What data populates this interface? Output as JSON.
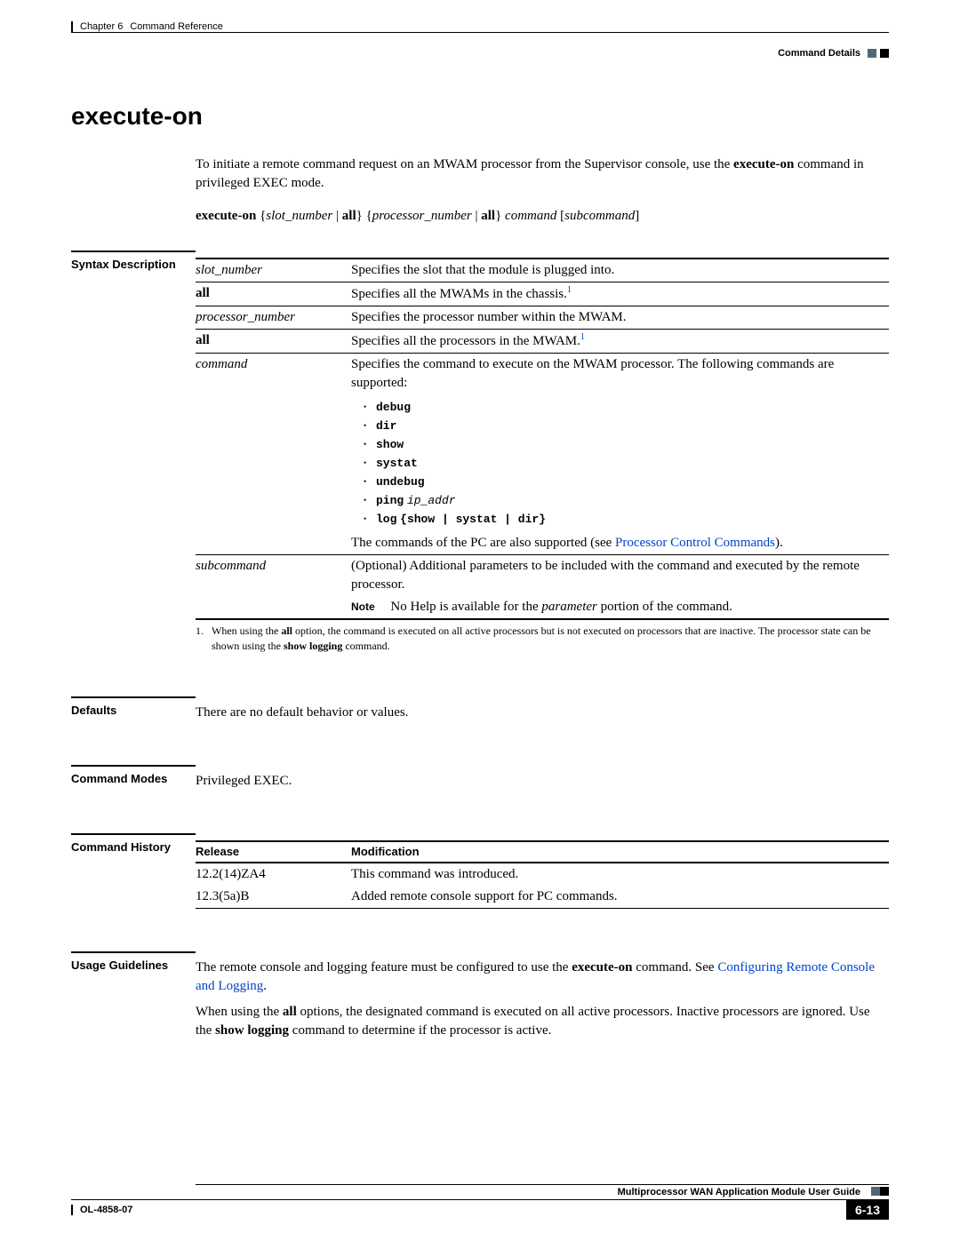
{
  "header": {
    "chapter": "Chapter 6",
    "chapter_title": "Command Reference",
    "section": "Command Details"
  },
  "title": "execute-on",
  "intro": {
    "text1": "To initiate a remote command request on an MWAM processor from the Supervisor console, use the ",
    "bold1": "execute-on",
    "text2": " command in privileged EXEC mode."
  },
  "syntax": {
    "cmd": "execute-on",
    "p1": "slot_number",
    "sep": " | ",
    "all": "all",
    "p2": "processor_number",
    "p3": "command",
    "p4": "subcommand"
  },
  "labels": {
    "syntax_desc": "Syntax Description",
    "defaults": "Defaults",
    "cmd_modes": "Command Modes",
    "cmd_history": "Command History",
    "usage": "Usage Guidelines"
  },
  "syntax_table": {
    "rows": [
      {
        "param": "slot_number",
        "style": "italic",
        "desc": "Specifies the slot that the module is plugged into."
      },
      {
        "param": "all",
        "style": "bold",
        "desc": "Specifies all the MWAMs in the chassis.",
        "sup": "1"
      },
      {
        "param": "processor_number",
        "style": "italic",
        "desc": "Specifies the processor number within the MWAM."
      },
      {
        "param": "all",
        "style": "bold",
        "desc": "Specifies all the processors in the MWAM.",
        "sup": "1"
      }
    ],
    "command": {
      "param": "command",
      "desc": "Specifies the command to execute on the MWAM processor. The following commands are supported:",
      "list": [
        {
          "cmd": "debug"
        },
        {
          "cmd": "dir"
        },
        {
          "cmd": "show"
        },
        {
          "cmd": "systat"
        },
        {
          "cmd": "undebug"
        },
        {
          "cmd": "ping",
          "arg": "ip_addr"
        },
        {
          "cmd": "log",
          "args_mono": "{show | systat | dir}"
        }
      ],
      "tail1": "The commands of the PC are also supported (see ",
      "link": "Processor Control Commands",
      "tail2": ")."
    },
    "subcommand": {
      "param": "subcommand",
      "desc": "(Optional) Additional parameters to be included with the command and executed by the remote processor.",
      "note_label": "Note",
      "note_text1": "No Help is available for the ",
      "note_italic": "parameter",
      "note_text2": " portion of the command."
    },
    "footnote": {
      "num": "1.",
      "t1": "When using the ",
      "b1": "all",
      "t2": " option, the command is executed on all active processors but is not executed on processors that are inactive. The processor state can be shown using the ",
      "b2": "show logging",
      "t3": " command."
    }
  },
  "defaults_text": "There are no default behavior or values.",
  "modes_text": "Privileged EXEC.",
  "history": {
    "h_rel": "Release",
    "h_mod": "Modification",
    "rows": [
      {
        "rel": "12.2(14)ZA4",
        "mod": "This command was introduced."
      },
      {
        "rel": "12.3(5a)B",
        "mod": "Added remote console support for PC commands."
      }
    ]
  },
  "usage": {
    "p1a": "The remote console and logging feature must be configured to use the ",
    "p1b": "execute-on",
    "p1c": " command. See ",
    "p1link": "Configuring Remote Console and Logging",
    "p1d": ".",
    "p2a": "When using the ",
    "p2b": "all",
    "p2c": " options, the designated command is executed on all active processors. Inactive processors are ignored. Use the ",
    "p2d": "show logging",
    "p2e": " command to determine if the processor is active."
  },
  "footer": {
    "book": "Multiprocessor WAN Application Module User Guide",
    "doc": "OL-4858-07",
    "page": "6-13"
  }
}
